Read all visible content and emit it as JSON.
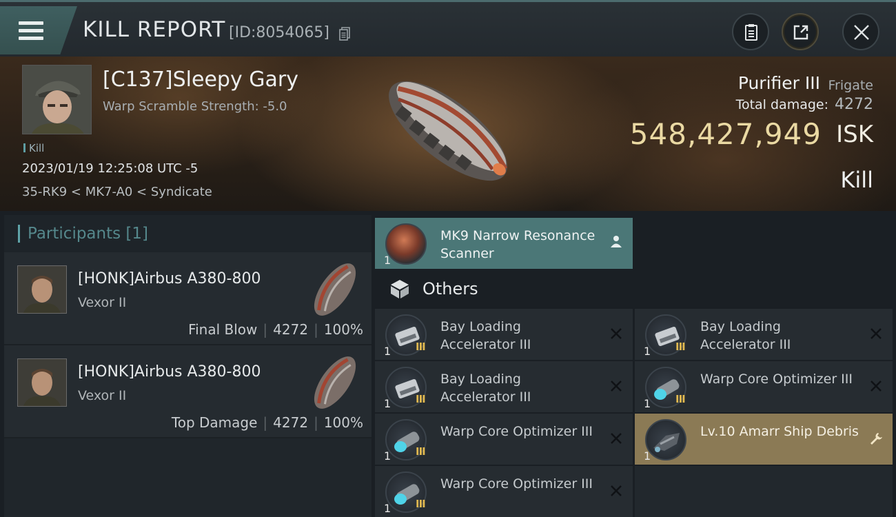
{
  "header": {
    "title": "KILL REPORT",
    "report_id": "[ID:8054065]"
  },
  "victim": {
    "name": "[C137]Sleepy Gary",
    "scramble": "Warp Scramble Strength: -5.0",
    "tag": "Kill",
    "datetime": "2023/01/19 12:25:08 UTC -5",
    "location": "35-RK9 < MK7-A0 < Syndicate",
    "ship_name": "Purifier III",
    "ship_class": "Frigate",
    "damage_label": "Total damage:",
    "damage_value": "4272",
    "isk_value": "548,427,949",
    "isk_unit": "ISK",
    "result": "Kill"
  },
  "participants": {
    "title": "Participants",
    "count": "[1]",
    "list": [
      {
        "name": "[HONK]Airbus A380-800",
        "ship": "Vexor II",
        "role": "Final Blow",
        "damage": "4272",
        "percent": "100%"
      },
      {
        "name": "[HONK]Airbus A380-800",
        "ship": "Vexor II",
        "role": "Top Damage",
        "damage": "4272",
        "percent": "100%"
      }
    ]
  },
  "items": {
    "top": {
      "qty": "1",
      "label": "MK9 Narrow Resonance Scanner",
      "icon": "scanner-icon"
    },
    "others_label": "Others",
    "list": [
      {
        "qty": "1",
        "tier": "III",
        "label": "Bay Loading Accelerator III",
        "icon": "bay-loading-accelerator-icon"
      },
      {
        "qty": "1",
        "tier": "III",
        "label": "Bay Loading Accelerator III",
        "icon": "bay-loading-accelerator-icon"
      },
      {
        "qty": "1",
        "tier": "III",
        "label": "Bay Loading Accelerator III",
        "icon": "bay-loading-accelerator-icon"
      },
      {
        "qty": "1",
        "tier": "III",
        "label": "Warp Core Optimizer III",
        "icon": "warp-core-optimizer-icon"
      },
      {
        "qty": "1",
        "tier": "III",
        "label": "Warp Core Optimizer III",
        "icon": "warp-core-optimizer-icon"
      },
      {
        "qty": "1",
        "tier": "",
        "label": "Lv.10 Amarr Ship Debris",
        "icon": "ship-debris-icon"
      },
      {
        "qty": "1",
        "tier": "III",
        "label": "Warp Core Optimizer III",
        "icon": "warp-core-optimizer-icon"
      }
    ]
  },
  "colors": {
    "accent_teal": "#5fa3a8",
    "isk_gold": "#ead9a3",
    "highlight_item": "#4b7777",
    "debris_item": "#8b7a55"
  }
}
